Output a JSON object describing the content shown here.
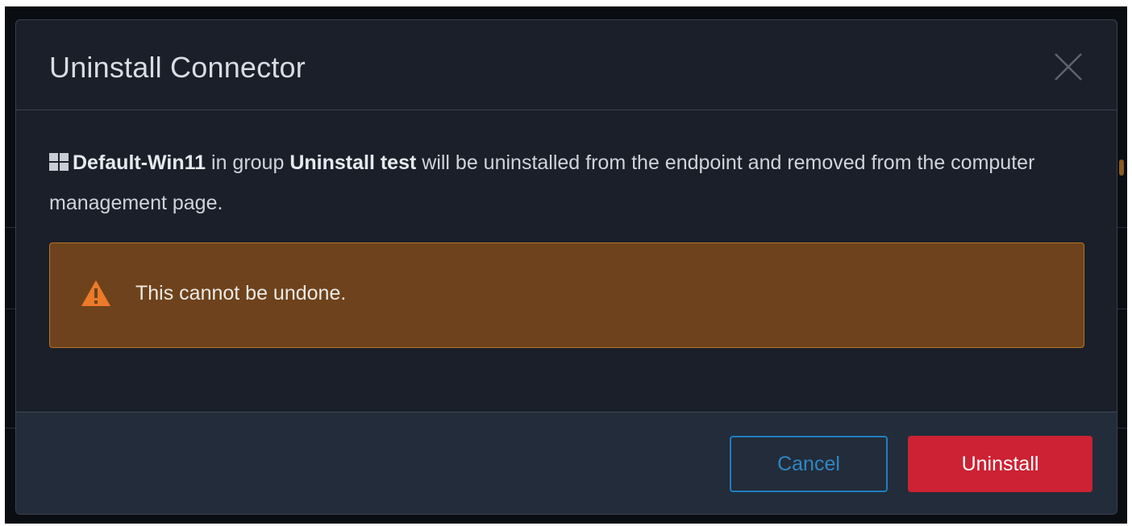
{
  "dialog": {
    "title": "Uninstall Connector",
    "message": {
      "computer_name": "Default-Win11",
      "text_in_group": " in group ",
      "group_name": "Uninstall test",
      "text_rest": " will be uninstalled from the endpoint and removed from the computer management page."
    },
    "warning": {
      "text": "This cannot be undone.",
      "icon": "warning-triangle-icon"
    },
    "buttons": {
      "cancel_label": "Cancel",
      "uninstall_label": "Uninstall"
    },
    "icons": {
      "close": "close-icon",
      "os": "windows-icon"
    }
  },
  "colors": {
    "modal_bg": "#1a1f29",
    "footer_bg": "#232c3a",
    "alert_bg": "#6e421c",
    "alert_border": "#b5722c",
    "cancel_accent": "#1f7fbf",
    "danger": "#cc2233"
  }
}
